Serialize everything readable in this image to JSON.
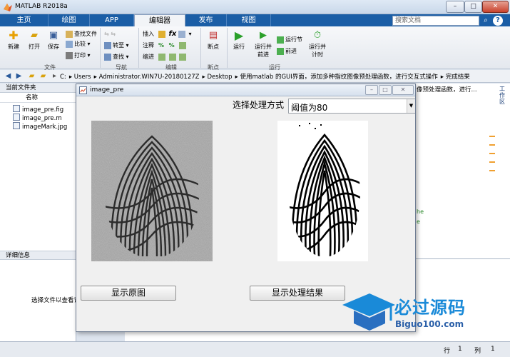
{
  "window": {
    "title": "MATLAB R2018a",
    "min_glyph": "–",
    "max_glyph": "□",
    "close_glyph": "✕"
  },
  "tabs": [
    {
      "label": "主页"
    },
    {
      "label": "绘图"
    },
    {
      "label": "APP"
    },
    {
      "label": "编辑器",
      "active": true
    },
    {
      "label": "发布"
    },
    {
      "label": "视图"
    }
  ],
  "search": {
    "placeholder": "搜索文档"
  },
  "ribbon": {
    "file": {
      "new_label": "新建",
      "open_label": "打开",
      "save_label": "保存",
      "find_files": "查找文件",
      "compare": "比较",
      "print": "打印",
      "group_label": "文件"
    },
    "navigate": {
      "goto": "转至",
      "find": "查找",
      "group_label": "导航"
    },
    "edit": {
      "insert": "插入",
      "comment": "注释",
      "indent": "缩进",
      "fx": "fx",
      "group_label": "编辑"
    },
    "breakpoints": {
      "label": "断点",
      "group_label": "断点"
    },
    "run": {
      "run": "运行",
      "run_advance_1": "运行并",
      "run_advance_2": "前进",
      "run_section": "运行节",
      "advance": "前进",
      "run_time_1": "运行并",
      "run_time_2": "计时",
      "group_label": "运行"
    }
  },
  "path": {
    "crumbs": [
      "C:",
      "Users",
      "Administrator.WIN7U-20180127Z",
      "Desktop",
      "使用matlab 的GUI界面，添加多种指纹图像预处理函数，进行交互式操作",
      "完成结果"
    ]
  },
  "left_panel": {
    "title": "当前文件夹",
    "column_header": "名称",
    "files": [
      "image_pre.fig",
      "image_pre.m",
      "imageMark.jpg"
    ],
    "detail_title": "详细信息",
    "detail_text": "选择文件以查看详"
  },
  "editor": {
    "tab_text": "像预处理函数，进行...",
    "workspace_label": "工作区",
    "code_frag_1": "he",
    "code_frag_2": "e"
  },
  "figure": {
    "title": "image_pre",
    "method_label": "选择处理方式",
    "method_value": "阈值为80",
    "show_original_button": "显示原图",
    "show_result_button": "显示处理结果"
  },
  "status": {
    "row_label": "行",
    "row_value": "1",
    "col_label": "列",
    "col_value": "1"
  },
  "watermark": {
    "brand": "必过源码",
    "url": "Biguo100.com"
  },
  "colors": {
    "tab_bar": "#1b5ea6",
    "watermark_blue": "#1a8ad8",
    "run_green": "#2aa02a"
  },
  "icons": {
    "back": "arrow-left-icon",
    "forward": "arrow-right-icon",
    "up": "folder-up-icon",
    "browse": "folder-browse-icon",
    "search": "search-icon",
    "help": "help-icon"
  }
}
